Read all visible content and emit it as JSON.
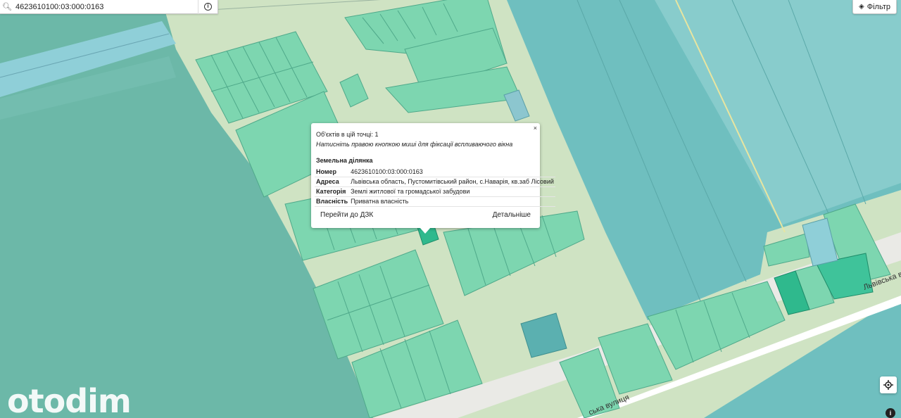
{
  "search": {
    "value": "4623610100:03:000:0163",
    "placeholder": ""
  },
  "filter_button": {
    "label": "Фільтр"
  },
  "popup": {
    "close_label": "×",
    "objects_count": "Об'єктів в цій точці: 1",
    "hint": "Натисніть правою кнопкою миші для фіксації вспливаючого вікна",
    "section_title": "Земельна ділянка",
    "fields": [
      {
        "key": "Номер",
        "value": "4623610100:03:000:0163"
      },
      {
        "key": "Адреса",
        "value": "Львівська область, Пустомитівський район, с.Наварія, кв.заб Лісовий"
      },
      {
        "key": "Категорія",
        "value": "Землі житлової та громадської забудови"
      },
      {
        "key": "Власність",
        "value": "Приватна власність"
      }
    ],
    "goto_button": "Перейти до ДЗК",
    "details_button": "Детальніше"
  },
  "street_labels": {
    "right": "Львівська ву",
    "bottom": "ська вулиця"
  },
  "watermark": "otodim",
  "colors": {
    "background": "#cfe3c3",
    "forest": "#6cb8a8",
    "parcel": "#7dd6b0",
    "parcel_selected": "#2fb98d",
    "water": "#8fcfd8",
    "road": "#eaeae6"
  },
  "icons": {
    "search": "magnifier-icon",
    "info": "info-icon",
    "filter": "layers-icon",
    "locate": "crosshair-icon"
  }
}
